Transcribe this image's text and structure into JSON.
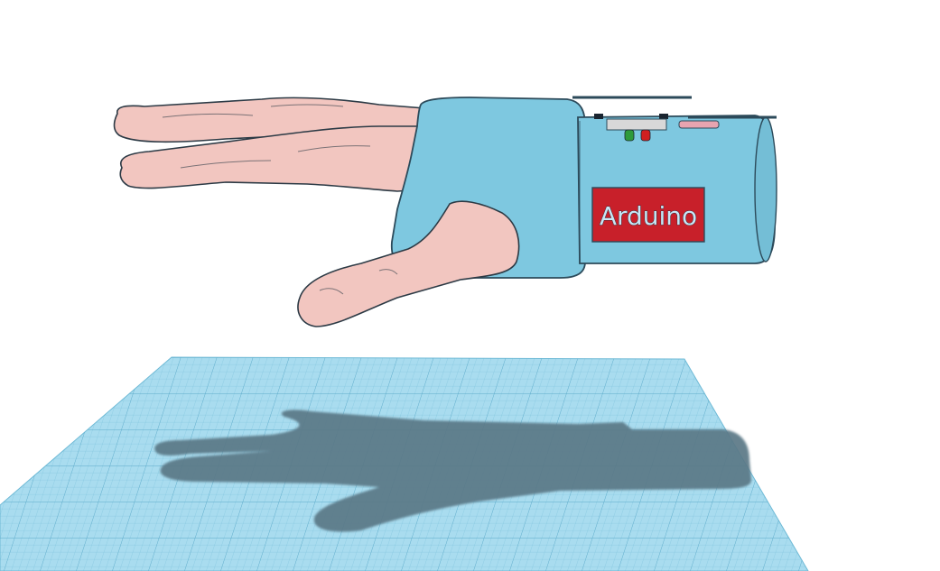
{
  "scene": {
    "label_text": "Arduino",
    "colors": {
      "background": "#ffffff",
      "workplane": "#7ec8e0",
      "grid_line": "#5fb0cf",
      "shadow": "#5a7885",
      "sleeve": "#7ec8e0",
      "sleeve_outline": "#2c4a5a",
      "skin": "#f2c6c0",
      "skin_outline": "#2c3a45",
      "label_box": "#c8202a",
      "led_green": "#2e9a3a",
      "led_red": "#d02020"
    },
    "icons": {
      "led_green": "led-green-icon",
      "led_red": "led-red-icon"
    }
  }
}
